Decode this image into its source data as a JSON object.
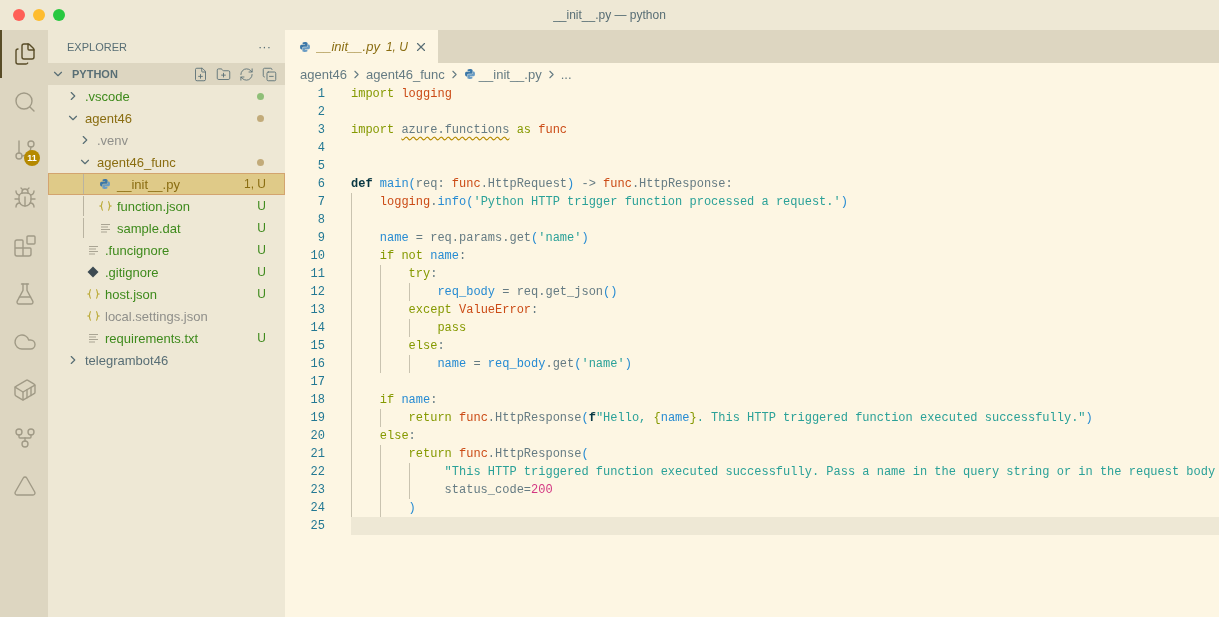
{
  "window": {
    "title": "__init__.py — python"
  },
  "activity_bar": [
    {
      "selected": true
    },
    {
      "selected": false
    },
    {
      "selected": false,
      "badge": "11"
    },
    {
      "selected": false
    },
    {
      "selected": false
    },
    {
      "selected": false
    },
    {
      "selected": false
    },
    {
      "selected": false
    },
    {
      "selected": false
    },
    {
      "selected": false
    }
  ],
  "sidebar": {
    "title": "EXPLORER",
    "more": "···",
    "section": {
      "title": "PYTHON",
      "expanded": true
    },
    "tree": [
      {
        "name": ".vscode",
        "kind": "folder",
        "expanded": false,
        "color": "#3e8a1c",
        "dot": {
          "color": "#8fbf78"
        },
        "selected": false
      },
      {
        "name": "agent46",
        "kind": "folder",
        "expanded": true,
        "color": "#8a6d11",
        "dot": {
          "color": "#c2ab7a"
        },
        "selected": false,
        "children": [
          {
            "name": ".venv",
            "kind": "folder",
            "expanded": false,
            "color": "#8f8f8a",
            "selected": false
          },
          {
            "name": "agent46_func",
            "kind": "folder",
            "expanded": true,
            "color": "#8a6d11",
            "dot": {
              "color": "#c2ab7a"
            },
            "selected": false,
            "children": [
              {
                "name": "__init__.py",
                "kind": "python",
                "color": "#8a6d11",
                "badge": "1, U",
                "selected": true
              },
              {
                "name": "function.json",
                "kind": "json",
                "color": "#3e8a1c",
                "badge": "U",
                "selected": false
              },
              {
                "name": "sample.dat",
                "kind": "text",
                "color": "#3e8a1c",
                "badge": "U",
                "selected": false
              }
            ]
          },
          {
            "name": ".funcignore",
            "kind": "text",
            "color": "#3e8a1c",
            "badge": "U",
            "selected": false
          },
          {
            "name": ".gitignore",
            "kind": "git",
            "color": "#3e8a1c",
            "badge": "U",
            "selected": false
          },
          {
            "name": "host.json",
            "kind": "json",
            "color": "#3e8a1c",
            "badge": "U",
            "selected": false
          },
          {
            "name": "local.settings.json",
            "kind": "json",
            "color": "#8f8f8a",
            "selected": false
          },
          {
            "name": "requirements.txt",
            "kind": "text",
            "color": "#3e8a1c",
            "badge": "U",
            "selected": false
          }
        ]
      },
      {
        "name": "telegrambot46",
        "kind": "folder",
        "expanded": false,
        "color": "#586e75",
        "selected": false
      }
    ]
  },
  "tabs": [
    {
      "label": "__init__.py",
      "decoration": "1, U",
      "selected": true
    }
  ],
  "breadcrumbs": [
    {
      "label": "agent46"
    },
    {
      "label": "agent46_func"
    },
    {
      "label": "__init__.py",
      "kind": "python"
    },
    {
      "label": "..."
    }
  ],
  "editor": {
    "lines": [
      {
        "n": "1",
        "tokens": [
          {
            "kind": "kw",
            "text": "import "
          },
          {
            "kind": "mod",
            "text": "logging"
          }
        ]
      },
      {
        "n": "2"
      },
      {
        "n": "3",
        "tokens": [
          {
            "kind": "kw",
            "text": "import "
          },
          {
            "kind": "warn",
            "text": "azure.functions"
          },
          {
            "kind": "kw",
            "text": " as "
          },
          {
            "kind": "mod",
            "text": "func"
          }
        ]
      },
      {
        "n": "4"
      },
      {
        "n": "5"
      },
      {
        "n": "6",
        "tokens": [
          {
            "kind": "def",
            "text": "def "
          },
          {
            "kind": "fn",
            "text": "main("
          },
          {
            "kind": "pl",
            "text": "req: "
          },
          {
            "kind": "mod",
            "text": "func"
          },
          {
            "kind": "pl",
            "text": ".HttpRequest"
          },
          {
            "kind": "fn",
            "text": ")"
          },
          {
            "kind": "pl",
            "text": " -> "
          },
          {
            "kind": "mod",
            "text": "func"
          },
          {
            "kind": "pl",
            "text": ".HttpResponse:"
          }
        ]
      },
      {
        "n": "7",
        "tokens": [
          {
            "kind": "mod",
            "text": "    logging"
          },
          {
            "kind": "pl",
            "text": "."
          },
          {
            "kind": "fn",
            "text": "info("
          },
          {
            "kind": "str",
            "text": "'Python HTTP trigger function processed a request.'"
          },
          {
            "kind": "fn",
            "text": ")"
          }
        ]
      },
      {
        "n": "8"
      },
      {
        "n": "9",
        "tokens": [
          {
            "kind": "var",
            "text": "    name"
          },
          {
            "kind": "pl",
            "text": " = req.params.get"
          },
          {
            "kind": "fn",
            "text": "("
          },
          {
            "kind": "str",
            "text": "'name'"
          },
          {
            "kind": "fn",
            "text": ")"
          }
        ]
      },
      {
        "n": "10",
        "tokens": [
          {
            "kind": "kw",
            "text": "    if not "
          },
          {
            "kind": "var",
            "text": "name"
          },
          {
            "kind": "pl",
            "text": ":"
          }
        ]
      },
      {
        "n": "11",
        "tokens": [
          {
            "kind": "kw",
            "text": "        try"
          },
          {
            "kind": "pl",
            "text": ":"
          }
        ]
      },
      {
        "n": "12",
        "tokens": [
          {
            "kind": "var",
            "text": "            req_body"
          },
          {
            "kind": "pl",
            "text": " = req.get_json"
          },
          {
            "kind": "fn",
            "text": "()"
          }
        ]
      },
      {
        "n": "13",
        "tokens": [
          {
            "kind": "kw",
            "text": "        except "
          },
          {
            "kind": "mod",
            "text": "ValueError"
          },
          {
            "kind": "pl",
            "text": ":"
          }
        ]
      },
      {
        "n": "14",
        "tokens": [
          {
            "kind": "kw",
            "text": "            pass"
          }
        ]
      },
      {
        "n": "15",
        "tokens": [
          {
            "kind": "kw",
            "text": "        else"
          },
          {
            "kind": "pl",
            "text": ":"
          }
        ]
      },
      {
        "n": "16",
        "tokens": [
          {
            "kind": "var",
            "text": "            name"
          },
          {
            "kind": "pl",
            "text": " = "
          },
          {
            "kind": "var",
            "text": "req_body"
          },
          {
            "kind": "pl",
            "text": ".get"
          },
          {
            "kind": "fn",
            "text": "("
          },
          {
            "kind": "str",
            "text": "'name'"
          },
          {
            "kind": "fn",
            "text": ")"
          }
        ]
      },
      {
        "n": "17"
      },
      {
        "n": "18",
        "tokens": [
          {
            "kind": "kw",
            "text": "    if "
          },
          {
            "kind": "var",
            "text": "name"
          },
          {
            "kind": "pl",
            "text": ":"
          }
        ]
      },
      {
        "n": "19",
        "tokens": [
          {
            "kind": "kw",
            "text": "        return "
          },
          {
            "kind": "mod",
            "text": "func"
          },
          {
            "kind": "pl",
            "text": ".HttpResponse"
          },
          {
            "kind": "fn",
            "text": "("
          },
          {
            "kind": "def",
            "text": "f"
          },
          {
            "kind": "str",
            "text": "\"Hello, "
          },
          {
            "kind": "kw",
            "text": "{"
          },
          {
            "kind": "var",
            "text": "name"
          },
          {
            "kind": "kw",
            "text": "}"
          },
          {
            "kind": "str",
            "text": ". This HTTP triggered function executed successfully.\""
          },
          {
            "kind": "fn",
            "text": ")"
          }
        ]
      },
      {
        "n": "20",
        "tokens": [
          {
            "kind": "kw",
            "text": "    else"
          },
          {
            "kind": "pl",
            "text": ":"
          }
        ]
      },
      {
        "n": "21",
        "tokens": [
          {
            "kind": "kw",
            "text": "        return "
          },
          {
            "kind": "mod",
            "text": "func"
          },
          {
            "kind": "pl",
            "text": ".HttpResponse"
          },
          {
            "kind": "fn",
            "text": "("
          }
        ]
      },
      {
        "n": "22",
        "tokens": [
          {
            "kind": "str",
            "text": "             \"This HTTP triggered function executed successfully. Pass a name in the query string or in the request body"
          }
        ]
      },
      {
        "n": "23",
        "tokens": [
          {
            "kind": "pl",
            "text": "             status_code="
          },
          {
            "kind": "num",
            "text": "200"
          }
        ]
      },
      {
        "n": "24",
        "tokens": [
          {
            "kind": "fn",
            "text": "        )"
          }
        ]
      },
      {
        "n": "25",
        "current": true
      }
    ]
  }
}
